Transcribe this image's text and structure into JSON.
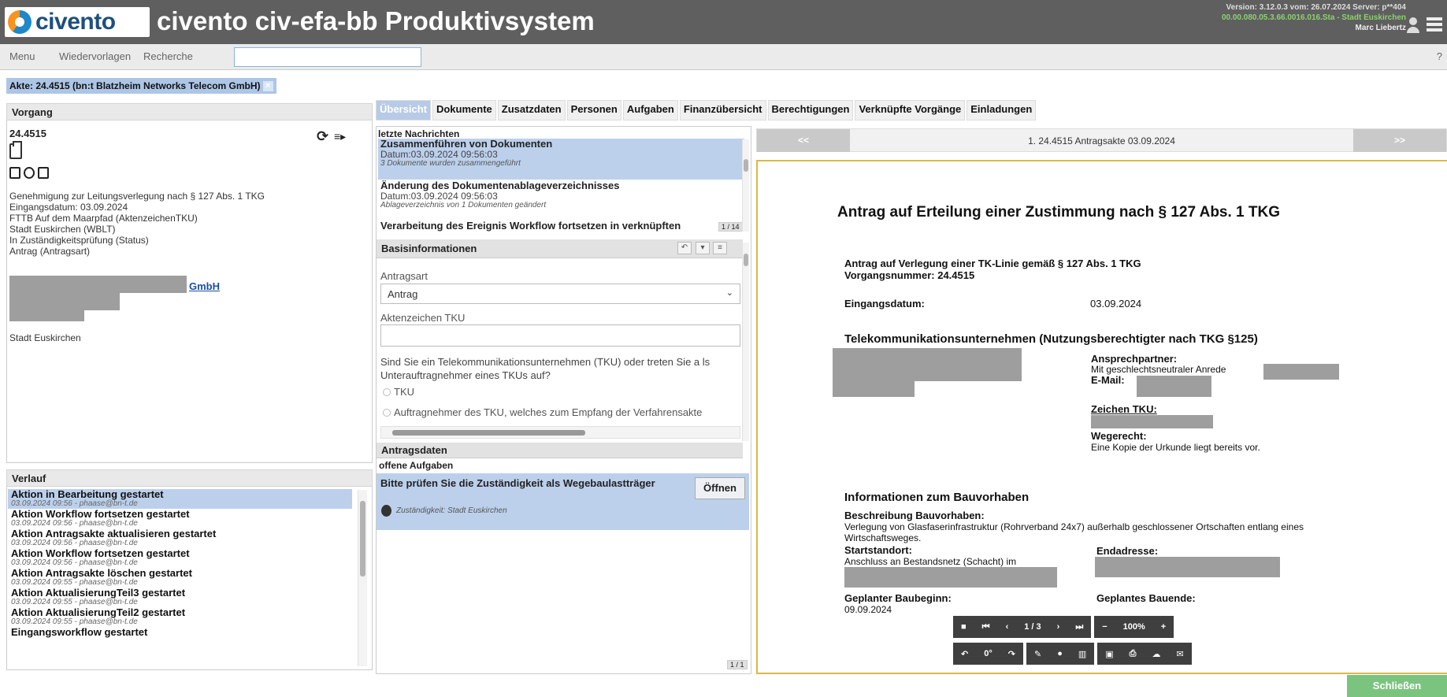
{
  "header": {
    "logo_text": "civento",
    "title": "civento civ-efa-bb Produktivsystem",
    "version_line": "Version: 3.12.0.3 vom: 26.07.2024 Server: p**404",
    "session_line": "00.00.080.05.3.66.0016.016.Sta - Stadt Euskirchen",
    "user": "Marc Liebertz",
    "colors": {
      "header_bg": "#5f5f5f",
      "accent": "#b7cbe6",
      "success": "#7bc47f"
    }
  },
  "toolbar": {
    "menu": "Menu",
    "wiedervorlagen": "Wiedervorlagen",
    "recherche": "Recherche",
    "search_value": "",
    "help": "?"
  },
  "akte_tab": {
    "label": "Akte: 24.4515 (bn:t Blatzheim Networks Telecom GmbH)",
    "close": "×"
  },
  "vorgang": {
    "title": "Vorgang",
    "number": "24.4515",
    "lines": [
      "Genehmigung zur Leitungsverlegung nach § 127 Abs. 1 TKG",
      "Eingangsdatum: 03.09.2024",
      "FTTB Auf dem Maarpfad (AktenzeichenTKU)",
      "Stadt Euskirchen (WBLT)",
      "In Zuständigkeitsprüfung (Status)",
      "Antrag (Antragsart)"
    ],
    "company_link": "GmbH",
    "stadt": "Stadt Euskirchen",
    "refresh": "⟳",
    "menu": "≡▸"
  },
  "verlauf": {
    "title": "Verlauf",
    "items": [
      {
        "title": "Aktion in Bearbeitung gestartet",
        "sub": "03.09.2024 09:56 - phaase@bn-t.de"
      },
      {
        "title": "Aktion Workflow fortsetzen gestartet",
        "sub": "03.09.2024 09:56 - phaase@bn-t.de"
      },
      {
        "title": "Aktion Antragsakte aktualisieren gestartet",
        "sub": "03.09.2024 09:56 - phaase@bn-t.de"
      },
      {
        "title": "Aktion Workflow fortsetzen gestartet",
        "sub": "03.09.2024 09:56 - phaase@bn-t.de"
      },
      {
        "title": "Aktion Antragsakte löschen gestartet",
        "sub": "03.09.2024 09:55 - phaase@bn-t.de"
      },
      {
        "title": "Aktion AktualisierungTeil3 gestartet",
        "sub": "03.09.2024 09:55 - phaase@bn-t.de"
      },
      {
        "title": "Aktion AktualisierungTeil2 gestartet",
        "sub": "03.09.2024 09:55 - phaase@bn-t.de"
      },
      {
        "title": "Eingangsworkflow gestartet",
        "sub": ""
      }
    ]
  },
  "tabs": [
    "Übersicht",
    "Dokumente",
    "Zusatzdaten",
    "Personen",
    "Aufgaben",
    "Finanzübersicht",
    "Berechtigungen",
    "Verknüpfte Vorgänge",
    "Einladungen"
  ],
  "nachrichten": {
    "title": "letzte Nachrichten",
    "items": [
      {
        "title": "Zusammenführen von Dokumenten",
        "date": "Datum:03.09.2024 09:56:03",
        "sub": "3 Dokumente wurden zusammengeführt"
      },
      {
        "title": "Änderung des Dokumentenablageverzeichnisses",
        "date": "Datum:03.09.2024 09:56:03",
        "sub": "Ablageverzeichnis von 1 Dokumenten geändert"
      },
      {
        "title": "Verarbeitung des Ereignis Workflow fortsetzen in verknüpften",
        "date": "",
        "sub": ""
      }
    ],
    "page": "1 / 14"
  },
  "basis": {
    "title": "Basisinformationen",
    "antragsart_label": "Antragsart",
    "antragsart_value": "Antrag",
    "aktenzeichen_label": "Aktenzeichen TKU",
    "aktenzeichen_value": "",
    "question": "Sind Sie ein Telekommunikationsunternehmen (TKU) oder treten Sie a ls Unterauftragnehmer eines TKUs auf?",
    "option1": "TKU",
    "option2": "Auftragnehmer des TKU, welches zum Empfang der Verfahrensakte",
    "next_section": "Antragsdaten"
  },
  "aufgaben": {
    "title": "offene Aufgaben",
    "task": "Bitte prüfen Sie die Zuständigkeit als Wegebaulastträger",
    "open_button": "Öffnen",
    "zustaendig": "Zuständigkeit: Stadt Euskirchen",
    "page": "1 / 1"
  },
  "viewer": {
    "prev": "<<",
    "next": ">>",
    "doc_title": "1. 24.4515 Antragsakte 03.09.2024"
  },
  "document": {
    "heading": "Antrag auf Erteilung einer Zustimmung nach § 127 Abs. 1 TKG",
    "sub1": "Antrag auf Verlegung einer TK-Linie gemäß § 127 Abs. 1 TKG",
    "sub2": "Vorgangsnummer: 24.4515",
    "eingang_label": "Eingangsdatum:",
    "eingang_value": "03.09.2024",
    "tku_heading": "Telekommunikationsunternehmen (Nutzungsberechtigter nach TKG §125)",
    "ansprech_label": "Ansprechpartner:",
    "ansprech_value": "Mit geschlechtsneutraler Anrede",
    "email_label": "E-Mail:",
    "zeichen_label": "Zeichen TKU:",
    "wegerecht_label": "Wegerecht:",
    "wegerecht_value": "Eine Kopie der Urkunde liegt bereits vor.",
    "bau_heading": "Informationen zum Bauvorhaben",
    "beschreibung_label": "Beschreibung Bauvorhaben:",
    "beschreibung_value": "Verlegung von Glasfaserinfrastruktur (Rohrverband 24x7) außerhalb geschlossener Ortschaften entlang eines Wirtschaftsweges.",
    "start_label": "Startstandort:",
    "start_value": "Anschluss an Bestandsnetz (Schacht) im",
    "end_label": "Endadresse:",
    "beginn_label": "Geplanter Baubeginn:",
    "beginn_value": "09.09.2024",
    "ende_label": "Geplantes Bauende:"
  },
  "doc_toolbar": {
    "page": "1 / 3",
    "zoom": "100%",
    "rotation": "0°"
  },
  "footer": {
    "close": "Schließen"
  }
}
